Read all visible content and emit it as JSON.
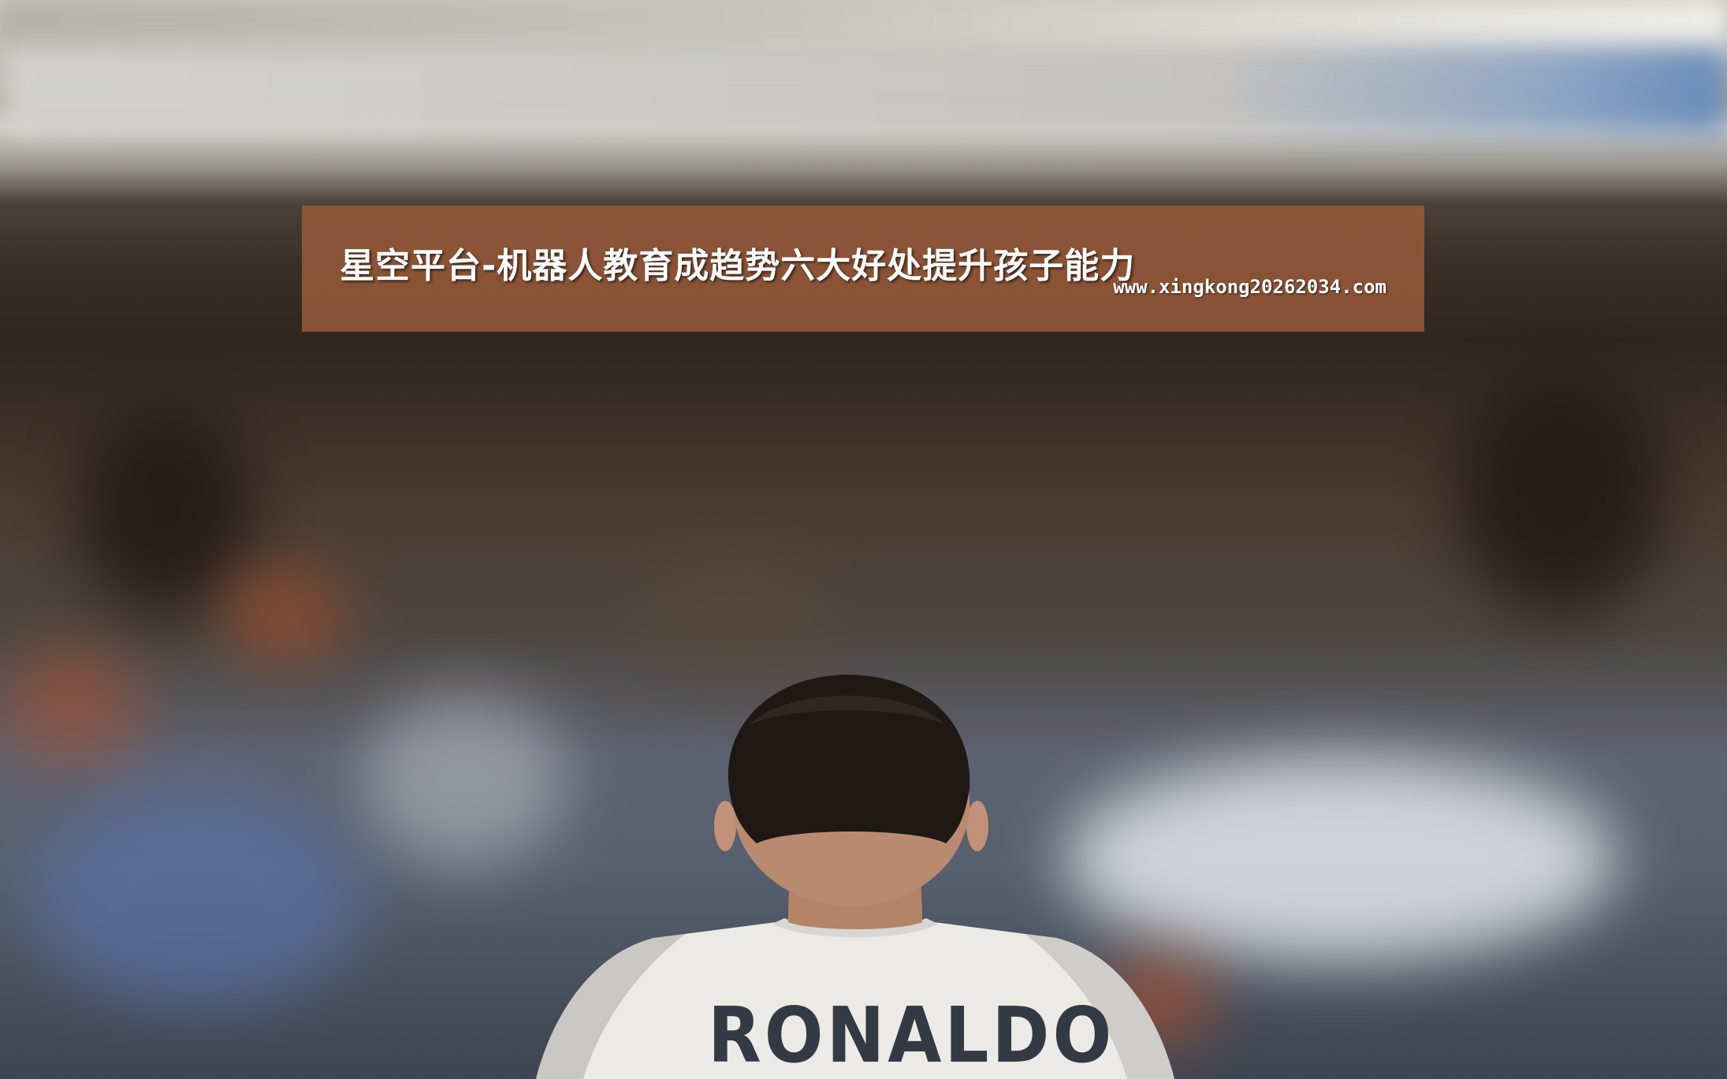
{
  "banner": {
    "title": "星空平台-机器人教育成趋势六大好处提升孩子能力",
    "url": "www.xingkong20262034.com"
  },
  "photo": {
    "jersey_name": "RONALDO"
  }
}
